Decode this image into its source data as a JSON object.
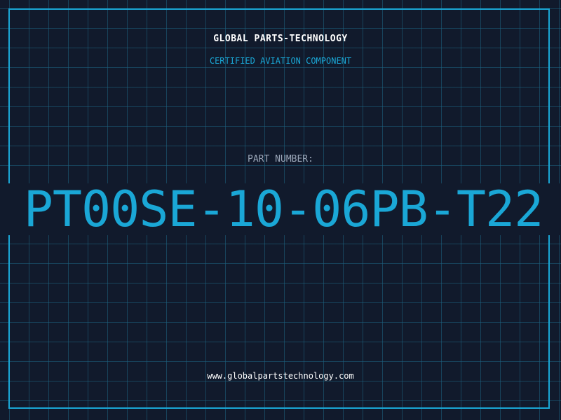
{
  "header": {
    "company": "GLOBAL PARTS-TECHNOLOGY",
    "subtitle": "CERTIFIED AVIATION COMPONENT"
  },
  "part": {
    "label": "PART NUMBER:",
    "number": "PT00SE-10-06PB-T22"
  },
  "footer": {
    "url": "www.globalpartstechnology.com"
  },
  "colors": {
    "background": "#111a2c",
    "accent": "#1aa7d6",
    "grid": "#1c6482",
    "label": "#9aa6b8",
    "text": "#ffffff"
  }
}
